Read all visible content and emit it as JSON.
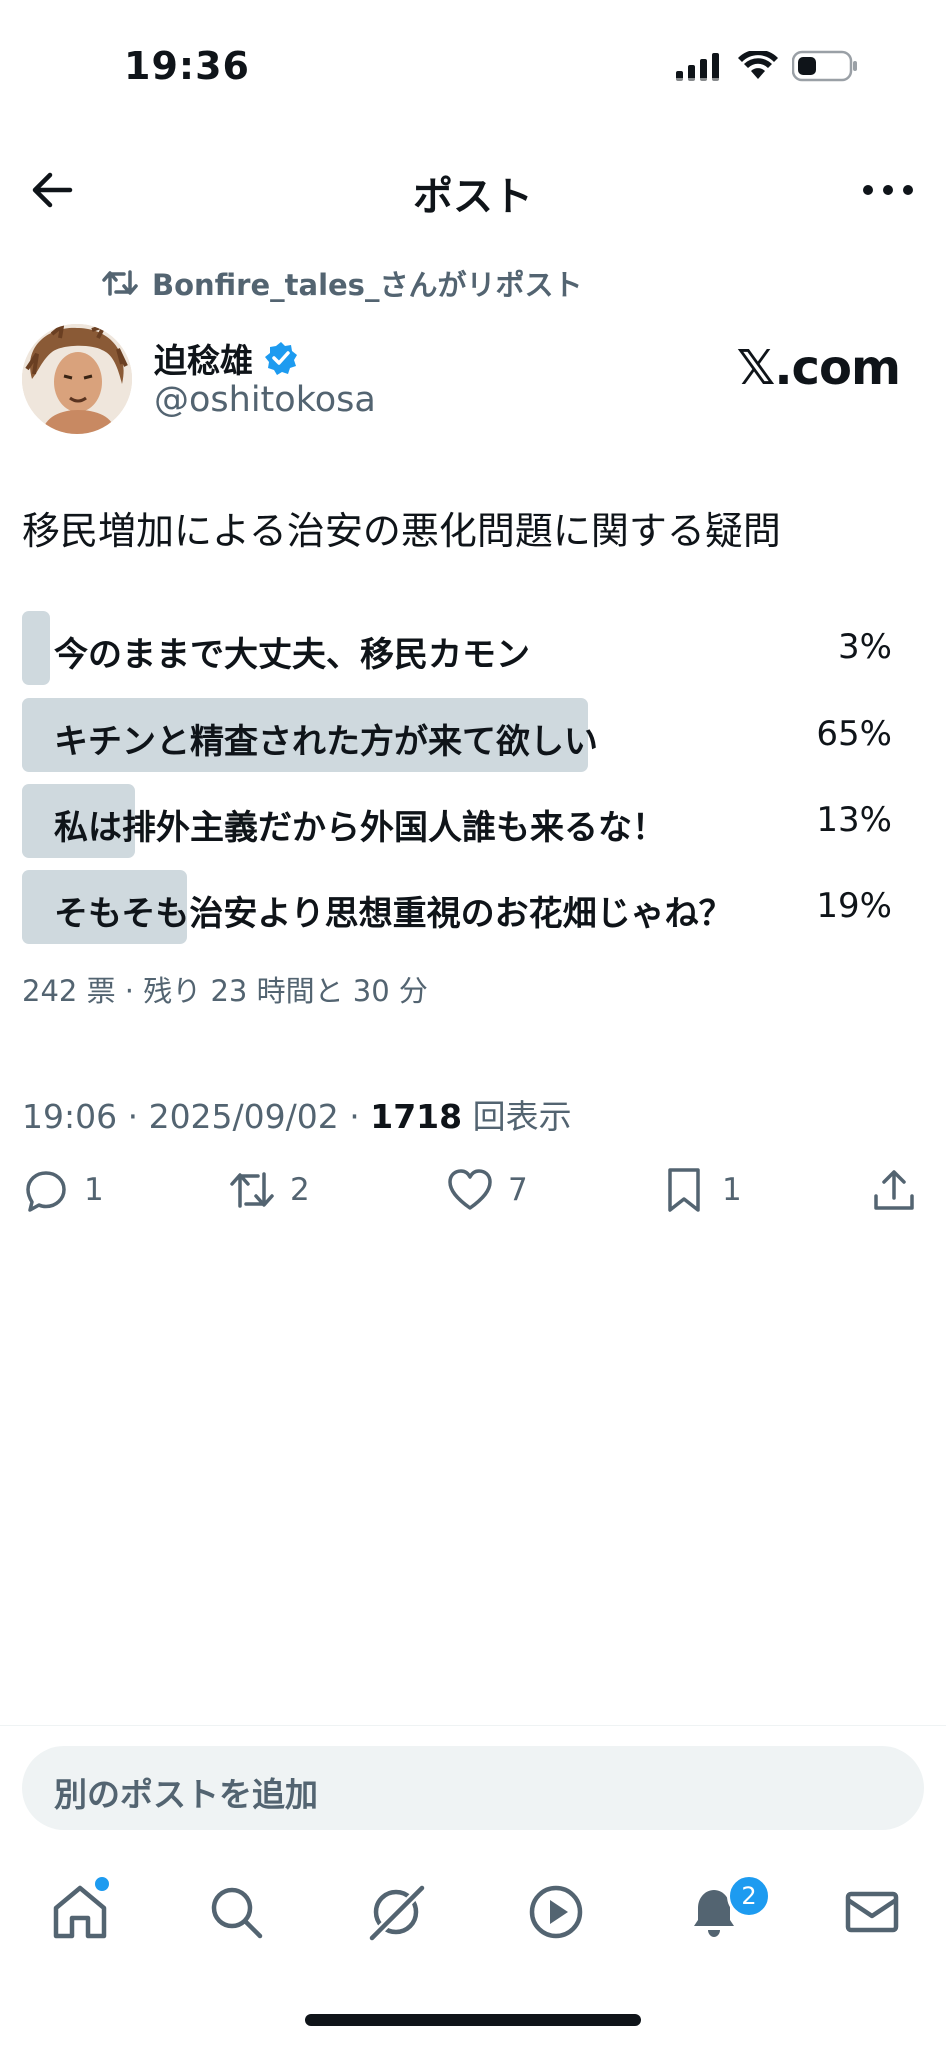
{
  "status_bar": {
    "time": "19:36"
  },
  "header": {
    "title": "ポスト"
  },
  "repost": {
    "text": "Bonfire_tales_さんがリポスト"
  },
  "author": {
    "name": "迫稔雄",
    "handle": "@oshitokosa"
  },
  "watermark": {
    "text": "𝕏",
    "suffix": ".com"
  },
  "tweet": {
    "text": "移民増加による治安の悪化問題に関する疑問"
  },
  "poll": {
    "options": [
      {
        "label": "今のままで大丈夫、移民カモン",
        "percent": "3%",
        "fraction": 0.03
      },
      {
        "label": "キチンと精査された方が来て欲しい",
        "percent": "65%",
        "fraction": 0.65
      },
      {
        "label": "私は排外主義だから外国人誰も来るな！",
        "percent": "13%",
        "fraction": 0.13
      },
      {
        "label": "そもそも治安より思想重視のお花畑じゃね？",
        "percent": "19%",
        "fraction": 0.19
      }
    ],
    "meta": "242 票 · 残り 23 時間と 30 分"
  },
  "timestamp": {
    "time_date": "19:06 · 2025/09/02 · ",
    "views": "1718",
    "views_label": " 回表示"
  },
  "actions": {
    "replies": "1",
    "reposts": "2",
    "likes": "7",
    "bookmarks": "1"
  },
  "compose": {
    "placeholder": "別のポストを追加"
  },
  "nav": {
    "notification_count": "2"
  },
  "colors": {
    "accent": "#1d9bf0",
    "poll_bar": "#cfd9de",
    "secondary_text": "#536471"
  }
}
